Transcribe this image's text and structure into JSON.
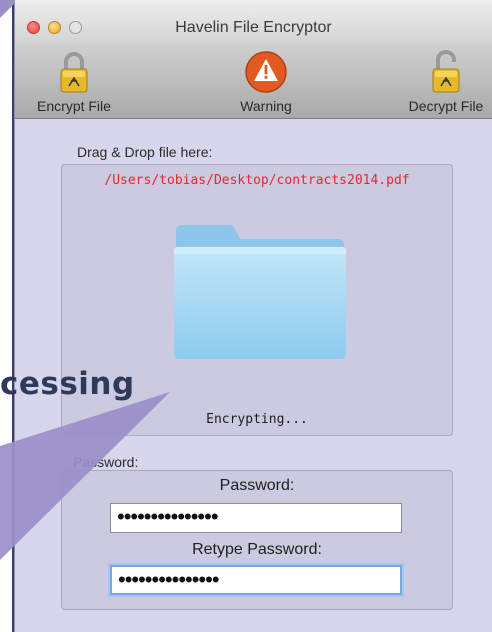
{
  "window": {
    "title": "Havelin File Encryptor"
  },
  "toolbar": {
    "encrypt_label": "Encrypt File",
    "warning_label": "Warning",
    "decrypt_label": "Decrypt File"
  },
  "drop": {
    "label": "Drag & Drop file here:",
    "file_path": "/Users/tobias/Desktop/contracts2014.pdf",
    "status": "Encrypting..."
  },
  "password": {
    "section_label": "Password:",
    "password_label": "Password:",
    "password_value": "•••••••••••••••",
    "retype_label": "Retype Password:",
    "retype_value": "•••••••••••••••"
  },
  "overlay": {
    "text": "cessing"
  },
  "colors": {
    "path_red": "#e8262f",
    "warning_orange": "#e15a22",
    "overlay_purple": "#9b8fc8",
    "focus_blue": "#7aa7de"
  },
  "icons": {
    "encrypt": "lock-closed-icon",
    "warning": "warning-icon",
    "decrypt": "lock-open-icon",
    "drop": "folder-icon"
  }
}
